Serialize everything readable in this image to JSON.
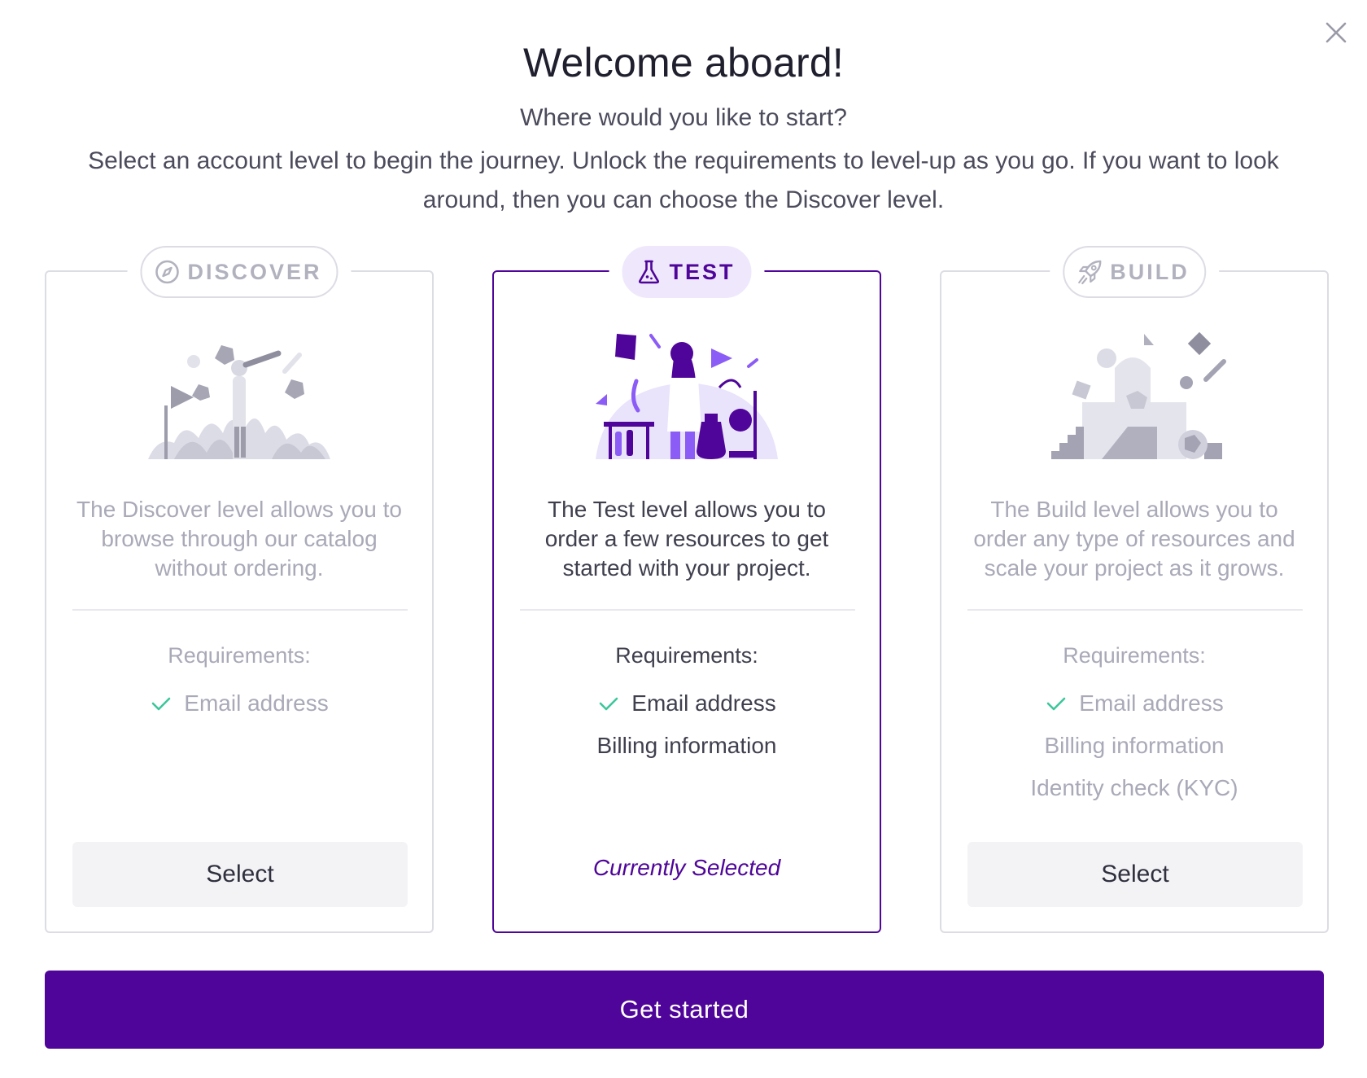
{
  "modal": {
    "close_icon": "close-icon",
    "title": "Welcome aboard!",
    "subtitle": "Where would you like to start?",
    "description": "Select an account level to begin the journey. Unlock the requirements to level-up as you go.   If you want to look around, then you can choose the Discover level."
  },
  "colors": {
    "accent": "#4f0599",
    "accent_light": "#efe8fc",
    "check": "#3cc69b",
    "muted_text": "#a9a9b8",
    "border": "#dcdce4"
  },
  "levels": [
    {
      "badge": "DISCOVER",
      "icon": "compass-icon",
      "description": "The Discover level allows you to browse through our catalog without ordering.",
      "requirements_title": "Requirements:",
      "requirements": [
        {
          "label": "Email address",
          "checked": true
        }
      ],
      "action_label": "Select",
      "selected": false
    },
    {
      "badge": "TEST",
      "icon": "flask-icon",
      "description": "The Test level allows you to order a few resources to get started with your project.",
      "requirements_title": "Requirements:",
      "requirements": [
        {
          "label": "Email address",
          "checked": true
        },
        {
          "label": "Billing information",
          "checked": false
        }
      ],
      "action_label": "Currently Selected",
      "selected": true
    },
    {
      "badge": "BUILD",
      "icon": "rocket-icon",
      "description": "The Build level allows you to order any type of resources and scale your project as it grows.",
      "requirements_title": "Requirements:",
      "requirements": [
        {
          "label": "Email address",
          "checked": true
        },
        {
          "label": "Billing information",
          "checked": false
        },
        {
          "label": "Identity check (KYC)",
          "checked": false
        }
      ],
      "action_label": "Select",
      "selected": false
    }
  ],
  "footer": {
    "cta_label": "Get started"
  }
}
